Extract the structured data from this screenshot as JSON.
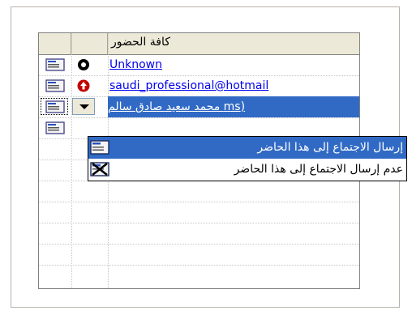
{
  "header": {
    "all_attendees_label": "كافة الحضور"
  },
  "rows": [
    {
      "name": "Unknown",
      "status_icon": "no-response-icon"
    },
    {
      "name": "saudi_professional@hotmail",
      "status_icon": "required-attendee-icon"
    },
    {
      "name": "(ms محمد سعيد صادق سالم",
      "status_icon": "dropdown-arrow-icon",
      "selected": true
    },
    {
      "name": "",
      "status_icon": ""
    }
  ],
  "menu": {
    "send_label": "إرسال الاجتماع إلى هذا الحاضر",
    "dont_send_label": "عدم إرسال الاجتماع إلى هذا الحاضر"
  },
  "colors": {
    "selection": "#316ac5",
    "link": "#0000ee",
    "header_bg": "#ece9d8",
    "required_icon_red": "#c00000"
  }
}
